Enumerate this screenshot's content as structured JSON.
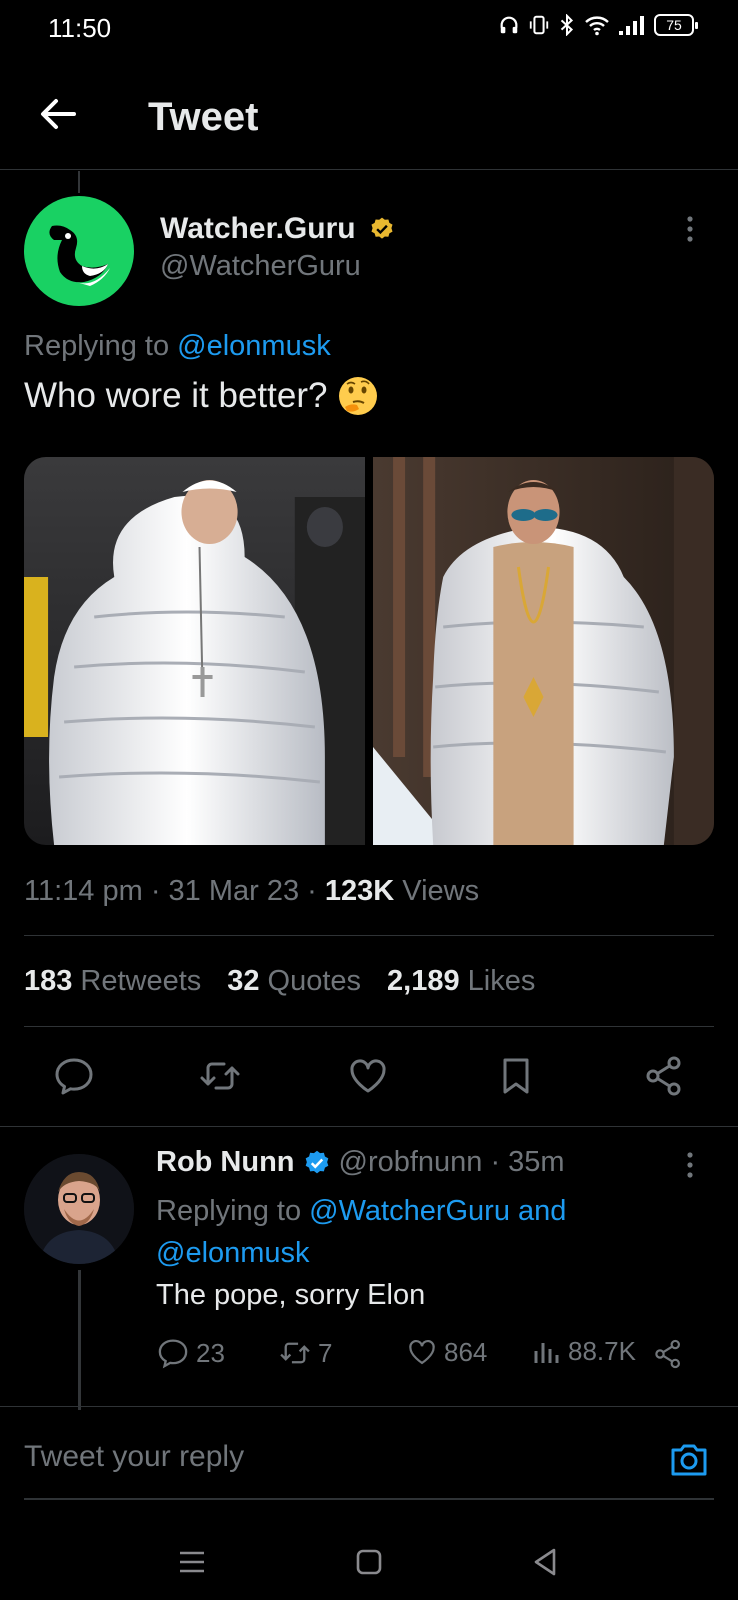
{
  "status_bar": {
    "time": "11:50",
    "battery": "75"
  },
  "header": {
    "title": "Tweet"
  },
  "tweet": {
    "author_name": "Watcher.Guru",
    "author_handle": "@WatcherGuru",
    "replying_prefix": "Replying to",
    "replying_mention": "@elonmusk",
    "text": "Who wore it better?",
    "time": "11:14 pm",
    "date": "31 Mar 23",
    "views_count": "123K",
    "views_label": "Views",
    "retweets_count": "183",
    "retweets_label": "Retweets",
    "quotes_count": "32",
    "quotes_label": "Quotes",
    "likes_count": "2,189",
    "likes_label": "Likes",
    "badge_color": "#e9b830",
    "avatar_color": "#19d163"
  },
  "reply": {
    "author_name": "Rob Nunn",
    "author_handle": "@robfnunn",
    "age": "35m",
    "replying_prefix": "Replying to",
    "mention_1": "@WatcherGuru and",
    "mention_2": "@elonmusk",
    "text": "The pope, sorry Elon",
    "replies": "23",
    "retweets": "7",
    "likes": "864",
    "views": "88.7K"
  },
  "composer": {
    "placeholder": "Tweet your reply"
  },
  "colors": {
    "accent": "#1d9bf0",
    "muted": "#71767b",
    "text": "#e7e9ea",
    "background": "#000000"
  }
}
